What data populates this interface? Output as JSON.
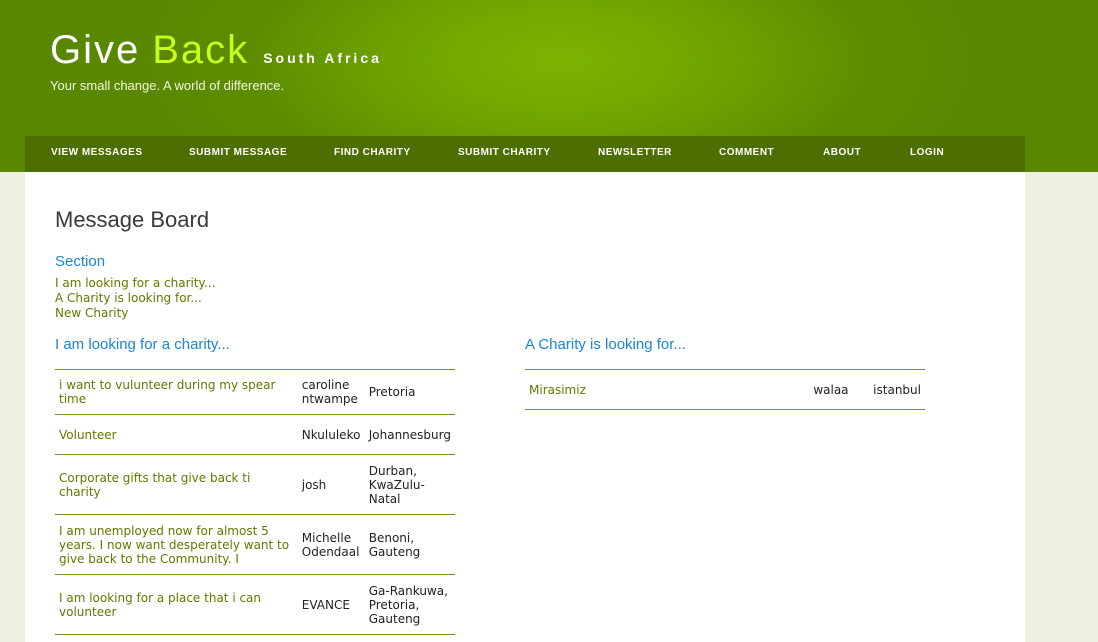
{
  "site": {
    "title_part1": "Give",
    "title_part2": "Back",
    "title_suffix": "South Africa",
    "tagline": "Your small change. A world of difference."
  },
  "nav": [
    "VIEW MESSAGES",
    "SUBMIT MESSAGE",
    "FIND CHARITY",
    "SUBMIT CHARITY",
    "NEWSLETTER",
    "COMMENT",
    "ABOUT",
    "LOGIN"
  ],
  "page": {
    "title": "Message Board",
    "section_heading": "Section",
    "section_links": [
      "I am looking for a charity...",
      "A Charity is looking for...",
      "New Charity"
    ]
  },
  "left_column": {
    "heading": "I am looking for a charity...",
    "rows": [
      {
        "title": "i want to vulunteer during my spear time",
        "name": "caroline ntwampe",
        "location": "Pretoria"
      },
      {
        "title": "Volunteer",
        "name": "Nkululeko",
        "location": "Johannesburg"
      },
      {
        "title": "Corporate gifts that give back ti charity",
        "name": "josh",
        "location": "Durban, KwaZulu-Natal"
      },
      {
        "title": "I am unemployed now for almost 5 years. I now want desperately want to give back to the Community. I",
        "name": "Michelle Odendaal",
        "location": "Benoni, Gauteng"
      },
      {
        "title": "I am looking for a place that i can volunteer",
        "name": "EVANCE",
        "location": "Ga-Rankuwa, Pretoria, Gauteng"
      }
    ]
  },
  "right_column": {
    "heading": "A Charity is looking for...",
    "rows": [
      {
        "title": "Mirasimiz",
        "name": "walaa",
        "location": "istanbul"
      }
    ]
  },
  "colors": {
    "header_green": "#5d8c00",
    "nav_bg": "#4d6e00",
    "accent_lime": "#c6ff1a",
    "heading_blue": "#1a86d6",
    "link_olive": "#667700",
    "rule_green": "#6c9a1e"
  }
}
